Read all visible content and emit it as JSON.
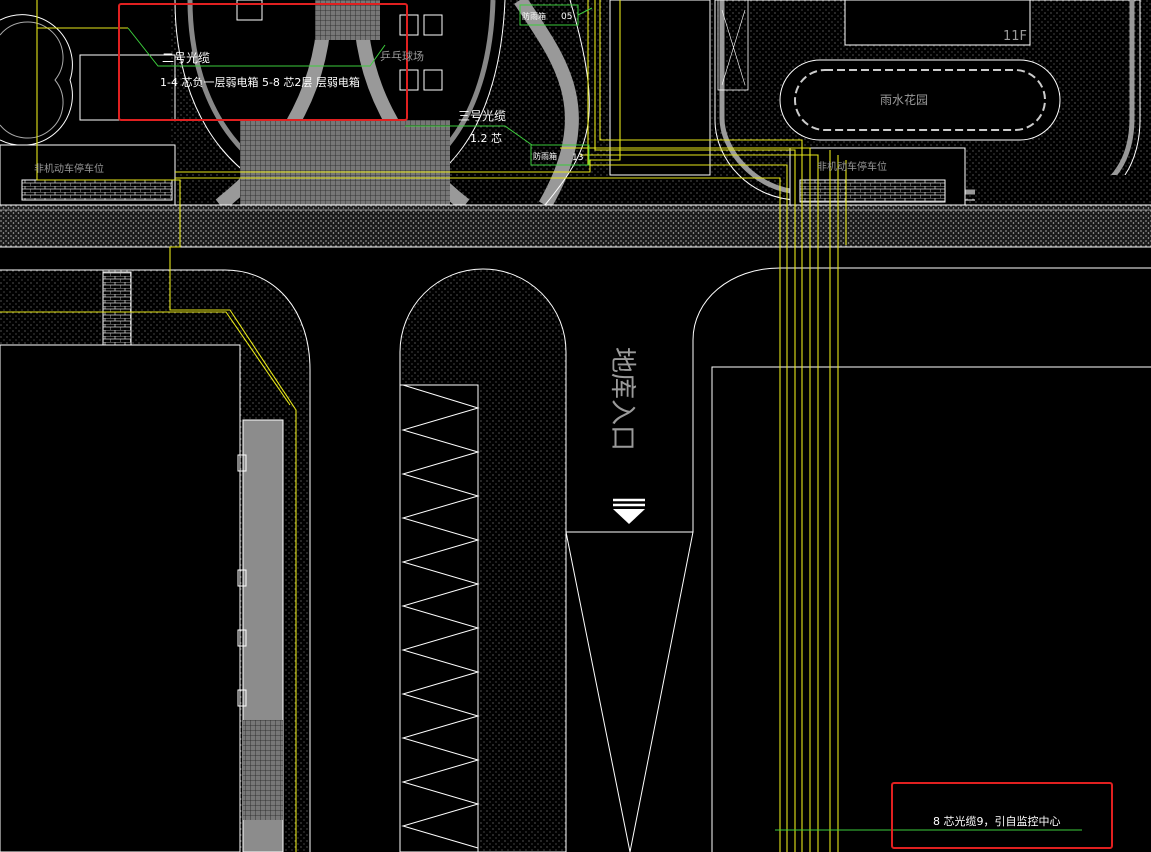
{
  "labels": {
    "cable_2_title": "二号光缆",
    "cable_2_detail": "1-4  芯负一层弱电箱 5-8  芯2层 层弱电箱",
    "cable_3_title": "三号光缆",
    "cable_3_detail": "1.2  芯",
    "box_05_name": "防雨箱",
    "box_05_num": "05",
    "box_13_name": "防雨箱",
    "box_13_num": "13",
    "basketball": "乒乓球场",
    "garden": "雨水花园",
    "floor": "11F",
    "bike_left": "非机动车停车位",
    "bike_right": "非机动车停车位",
    "garage": "地库入口",
    "monitor_note": "8 芯光缆9，引自监控中心"
  },
  "colors": {
    "background": "#000000",
    "line": "#ffffff",
    "cable": "#e6e61a",
    "leader": "#3ccc3c",
    "hatch_fill": "#8c8c8c",
    "highlight": "#e02020"
  }
}
